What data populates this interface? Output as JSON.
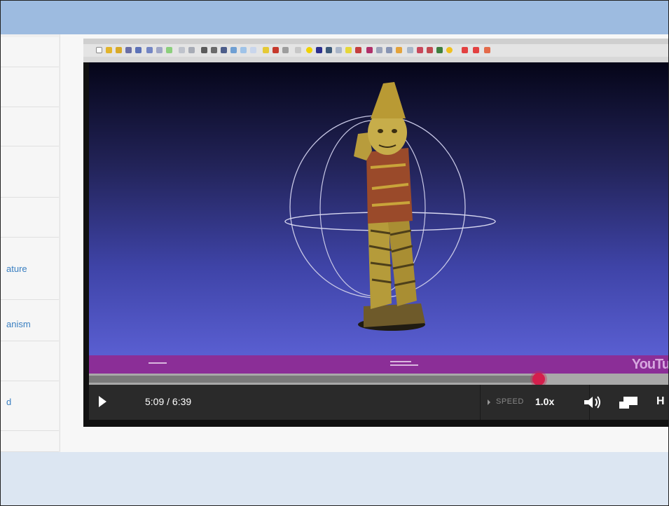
{
  "sidebar": {
    "items": [
      {
        "label": ""
      },
      {
        "label": ""
      },
      {
        "label": ""
      },
      {
        "label": ""
      },
      {
        "label": ""
      },
      {
        "label": "ature"
      },
      {
        "label": "anism"
      },
      {
        "label": ""
      },
      {
        "label": "d"
      },
      {
        "label": ""
      }
    ]
  },
  "video": {
    "current_time": "5:09",
    "duration": "6:39",
    "time_display": "5:09 / 6:39",
    "progress_fraction": 0.774,
    "speed_label": "SPEED",
    "speed_value": "1.0x",
    "hd_label": "H",
    "watermark": "YouTu"
  },
  "colors": {
    "top_bar": "#9dbbe0",
    "scrubber": "#d31f4d",
    "controls_bg": "#2a2a2a",
    "band": "#8b2e97"
  }
}
